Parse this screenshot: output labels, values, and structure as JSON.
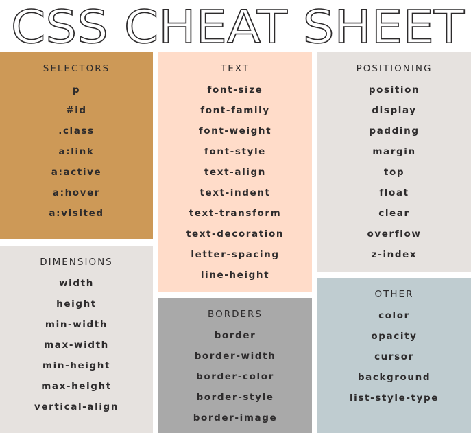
{
  "title": "CSS CHEAT SHEET",
  "colors": {
    "selectors": "#CD9957",
    "text": "#FFDCC9",
    "positioning": "#E6E2DF",
    "dimensions": "#E6E2DF",
    "borders": "#A9A9A9",
    "other": "#BFCCD0",
    "ink": "#2D2B2C"
  },
  "sections": {
    "selectors": {
      "heading": "SELECTORS",
      "items": [
        "p",
        "#id",
        ".class",
        "a:link",
        "a:active",
        "a:hover",
        "a:visited"
      ]
    },
    "text": {
      "heading": "TEXT",
      "items": [
        "font-size",
        "font-family",
        "font-weight",
        "font-style",
        "text-align",
        "text-indent",
        "text-transform",
        "text-decoration",
        "letter-spacing",
        "line-height"
      ]
    },
    "positioning": {
      "heading": "POSITIONING",
      "items": [
        "position",
        "display",
        "padding",
        "margin",
        "top",
        "float",
        "clear",
        "overflow",
        "z-index"
      ]
    },
    "dimensions": {
      "heading": "DIMENSIONS",
      "items": [
        "width",
        "height",
        "min-width",
        "max-width",
        "min-height",
        "max-height",
        "vertical-align"
      ]
    },
    "borders": {
      "heading": "BORDERS",
      "items": [
        "border",
        "border-width",
        "border-color",
        "border-style",
        "border-image"
      ]
    },
    "other": {
      "heading": "OTHER",
      "items": [
        "color",
        "opacity",
        "cursor",
        "background",
        "list-style-type"
      ]
    }
  }
}
